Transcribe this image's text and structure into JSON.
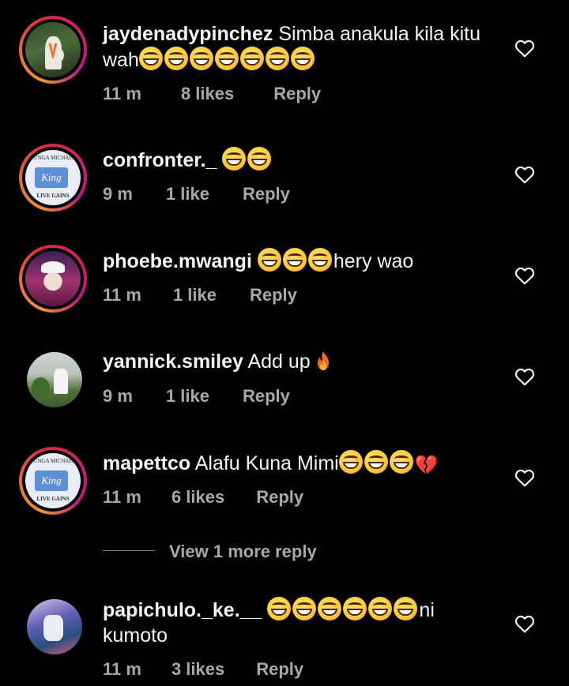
{
  "comments": [
    {
      "username": "jaydenadypinchez",
      "text_before": "Simba anakula kila kitu wah",
      "emojis": [
        "😂",
        "😂",
        "😂",
        "😂",
        "😂",
        "😂",
        "😂"
      ],
      "text_after": "",
      "time": "11 m",
      "likes": "8 likes",
      "reply": "Reply",
      "avatar_icon": "avatar-photo"
    },
    {
      "username": "confronter._",
      "text_before": "",
      "emojis": [
        "😂",
        "😂"
      ],
      "text_after": "",
      "time": "9 m",
      "likes": "1 like",
      "reply": "Reply",
      "avatar_icon": "avatar-logo",
      "avatar_text_top": "TUNGA MICHAEL",
      "avatar_text_mid": "King",
      "avatar_text_bot": "LIVE GAINS"
    },
    {
      "username": "phoebe.mwangi",
      "text_before": "",
      "emojis": [
        "😂",
        "😂",
        "😂"
      ],
      "text_after": "hery wao",
      "time": "11 m",
      "likes": "1 like",
      "reply": "Reply",
      "avatar_icon": "avatar-photo"
    },
    {
      "username": "yannick.smiley",
      "text_before": "Add up",
      "emojis": [],
      "text_after": "",
      "trailing_icon": "fire-emoji",
      "time": "9 m",
      "likes": "1 like",
      "reply": "Reply",
      "avatar_icon": "avatar-photo"
    },
    {
      "username": "mapettco",
      "text_before": "Alafu Kuna Mimi",
      "emojis": [
        "😂",
        "😂",
        "😂"
      ],
      "text_after": "",
      "trailing_icon": "broken-heart-emoji",
      "time": "11 m",
      "likes": "6 likes",
      "reply": "Reply",
      "avatar_icon": "avatar-logo",
      "avatar_text_top": "TUNGA MICHAEL",
      "avatar_text_mid": "King",
      "avatar_text_bot": "LIVE GAINS"
    },
    {
      "username": "papichulo._ke.__",
      "text_before": "",
      "emojis": [
        "😂",
        "😆",
        "😆",
        "😆",
        "😆",
        "😆"
      ],
      "text_after": "ni kumoto",
      "time": "11 m",
      "likes": "3 likes",
      "reply": "Reply",
      "avatar_icon": "avatar-photo"
    }
  ],
  "view_more": "View 1 more reply",
  "colors": {
    "background": "#000000",
    "text": "#f5f5f5",
    "meta": "#a8a8a8",
    "story_ring": "#dc2743"
  },
  "icons": {
    "like": "heart-outline-icon"
  }
}
